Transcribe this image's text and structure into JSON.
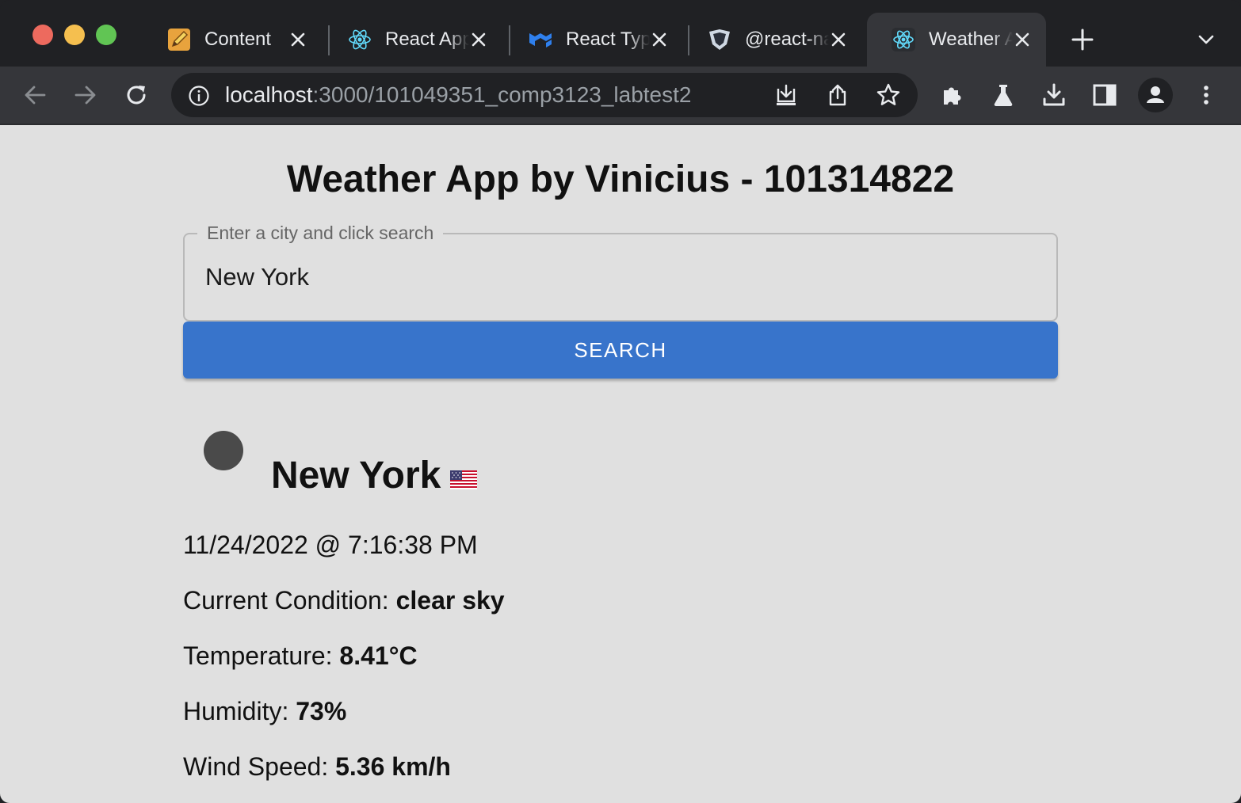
{
  "browser": {
    "tabs": [
      {
        "title": "Content",
        "icon": "pencil-icon"
      },
      {
        "title": "React App",
        "icon": "react-icon"
      },
      {
        "title": "React TypeScript",
        "icon": "mui-icon"
      },
      {
        "title": "@react-navigation",
        "icon": "shield-icon"
      },
      {
        "title": "Weather App",
        "icon": "react-icon",
        "active": true
      }
    ],
    "url": {
      "host": "localhost",
      "path": ":3000/101049351_comp3123_labtest2"
    }
  },
  "app": {
    "title": "Weather App by Vinicius - 101314822",
    "search": {
      "label": "Enter a city and click search",
      "value": "New York",
      "button_label": "SEARCH"
    },
    "result": {
      "city": "New York",
      "country_flag": "US",
      "datetime": "11/24/2022 @ 7:16:38 PM",
      "condition_label": "Current Condition:",
      "condition_value": "clear sky",
      "temperature_label": "Temperature:",
      "temperature_value": "8.41°C",
      "humidity_label": "Humidity:",
      "humidity_value": "73%",
      "wind_label": "Wind Speed:",
      "wind_value": "5.36 km/h"
    }
  },
  "colors": {
    "page_background": "#e0e0e0",
    "button_blue": "#3874cb",
    "tabstrip": "#202124",
    "toolbar": "#35363a"
  }
}
